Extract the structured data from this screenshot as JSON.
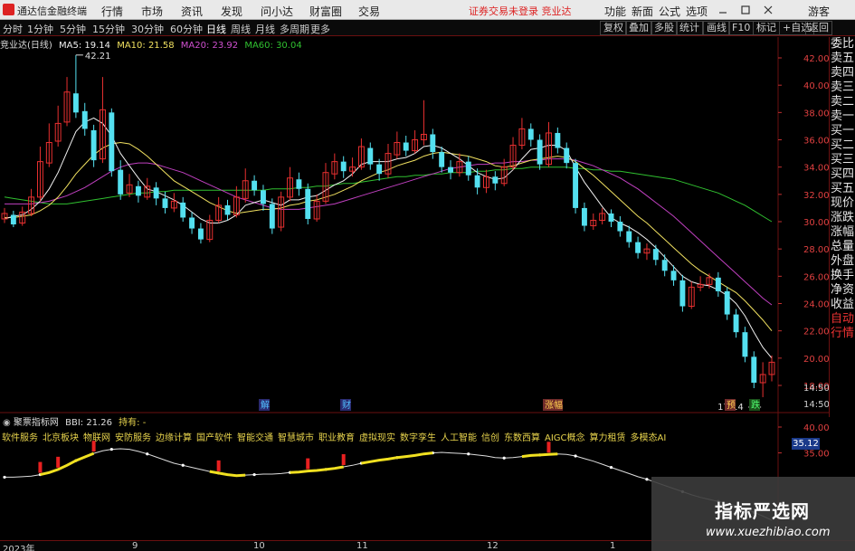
{
  "menubar": {
    "app_name": "通达信金融终端",
    "items": [
      "行情",
      "市场",
      "资讯",
      "发现",
      "问小达",
      "财富圈",
      "交易"
    ],
    "warning": "证券交易未登录 竞业达",
    "right_items": [
      "功能",
      "新面",
      "公式",
      "选项"
    ],
    "guest": "游客"
  },
  "toolbar": {
    "periods": [
      "分时",
      "1分钟",
      "5分钟",
      "15分钟",
      "30分钟",
      "60分钟",
      "日线",
      "周线",
      "月线",
      "多周期",
      "更多"
    ],
    "active_period": "日线",
    "right_buttons": [
      "复权",
      "叠加",
      "多股",
      "统计",
      "画线",
      "F10",
      "标记",
      "+自选",
      "返回"
    ]
  },
  "chart_header": {
    "stock": "竞业达(日线)",
    "ma5": "MA5: 19.14",
    "ma10": "MA10: 21.58",
    "ma20": "MA20: 23.92",
    "ma60": "MA60: 30.04"
  },
  "price_axis": {
    "ticks": [
      "42.00",
      "40.00",
      "38.00",
      "36.00",
      "34.00",
      "32.00",
      "30.00",
      "28.00",
      "26.00",
      "24.00",
      "22.00",
      "20.00",
      "18.00"
    ],
    "time_labels": [
      "14:50",
      "14:50",
      "14:50",
      "14:50"
    ]
  },
  "side_panel": [
    "委比",
    "卖五",
    "卖四",
    "卖三",
    "卖二",
    "卖一",
    "买一",
    "买二",
    "买三",
    "买四",
    "买五",
    "现价",
    "涨跌",
    "涨幅",
    "总量",
    "外盘",
    "换手",
    "净资",
    "收益",
    "自动",
    "行情"
  ],
  "markers": {
    "high_label": "42.21",
    "low_label": "17.14",
    "events": [
      "解",
      "财",
      "涨幅",
      "预",
      "跌"
    ]
  },
  "indicator": {
    "title": "聚票指标网",
    "bbi": "BBI: 21.26",
    "hold": "持有: -",
    "concepts": [
      "软件服务",
      "北京板块",
      "物联网",
      "安防服务",
      "边缘计算",
      "国产软件",
      "智能交通",
      "智慧城市",
      "职业教育",
      "虚拟现实",
      "数字孪生",
      "人工智能",
      "信创",
      "东数西算",
      "AIGC概念",
      "算力租赁",
      "多模态AI"
    ],
    "axis_ticks": [
      "40.00",
      "35.00"
    ],
    "current_value": "35.12"
  },
  "bottom_axis": [
    "2023年",
    "9",
    "10",
    "11",
    "12",
    "1"
  ],
  "watermark": {
    "title": "指标严选网",
    "url": "www.xuezhibiao.com"
  },
  "colors": {
    "up": "#e83030",
    "down": "#54e0f0",
    "ma5": "#f0f0f0",
    "ma10": "#f0e060",
    "ma20": "#c040c0",
    "ma60": "#30c030",
    "bg": "#000000",
    "axis": "#6a1010"
  },
  "chart_data": {
    "type": "candlestick",
    "title": "竞业达(日线)",
    "ylim": [
      17,
      43
    ],
    "candles": [
      {
        "o": 30.2,
        "c": 30.6,
        "h": 31.0,
        "l": 29.9
      },
      {
        "o": 30.5,
        "c": 29.8,
        "h": 30.8,
        "l": 29.6
      },
      {
        "o": 29.9,
        "c": 30.7,
        "h": 31.1,
        "l": 29.7
      },
      {
        "o": 30.6,
        "c": 31.8,
        "h": 32.4,
        "l": 30.4
      },
      {
        "o": 31.8,
        "c": 34.4,
        "h": 35.5,
        "l": 31.5
      },
      {
        "o": 34.3,
        "c": 35.8,
        "h": 37.2,
        "l": 34.0
      },
      {
        "o": 35.9,
        "c": 37.2,
        "h": 38.5,
        "l": 35.5
      },
      {
        "o": 37.3,
        "c": 39.5,
        "h": 40.6,
        "l": 37.0
      },
      {
        "o": 39.4,
        "c": 38.0,
        "h": 42.21,
        "l": 37.6
      },
      {
        "o": 38.1,
        "c": 36.8,
        "h": 38.7,
        "l": 36.3
      },
      {
        "o": 36.7,
        "c": 34.5,
        "h": 37.1,
        "l": 34.0
      },
      {
        "o": 34.6,
        "c": 38.2,
        "h": 40.6,
        "l": 34.3
      },
      {
        "o": 38.0,
        "c": 33.7,
        "h": 38.3,
        "l": 33.3
      },
      {
        "o": 33.8,
        "c": 32.0,
        "h": 34.5,
        "l": 31.6
      },
      {
        "o": 32.1,
        "c": 32.7,
        "h": 33.5,
        "l": 31.8
      },
      {
        "o": 32.6,
        "c": 31.9,
        "h": 33.0,
        "l": 31.4
      },
      {
        "o": 31.8,
        "c": 32.6,
        "h": 33.2,
        "l": 31.6
      },
      {
        "o": 32.5,
        "c": 31.7,
        "h": 32.9,
        "l": 31.2
      },
      {
        "o": 31.7,
        "c": 31.0,
        "h": 32.2,
        "l": 30.6
      },
      {
        "o": 31.0,
        "c": 31.5,
        "h": 32.1,
        "l": 30.7
      },
      {
        "o": 31.4,
        "c": 30.3,
        "h": 31.8,
        "l": 30.0
      },
      {
        "o": 30.3,
        "c": 29.5,
        "h": 30.7,
        "l": 29.1
      },
      {
        "o": 29.5,
        "c": 28.7,
        "h": 29.9,
        "l": 28.4
      },
      {
        "o": 28.7,
        "c": 30.1,
        "h": 30.5,
        "l": 28.5
      },
      {
        "o": 30.1,
        "c": 31.2,
        "h": 31.8,
        "l": 29.9
      },
      {
        "o": 31.2,
        "c": 30.5,
        "h": 31.6,
        "l": 30.1
      },
      {
        "o": 30.5,
        "c": 31.8,
        "h": 32.6,
        "l": 30.3
      },
      {
        "o": 31.7,
        "c": 33.0,
        "h": 33.9,
        "l": 31.4
      },
      {
        "o": 33.0,
        "c": 32.3,
        "h": 33.4,
        "l": 31.9
      },
      {
        "o": 32.3,
        "c": 31.3,
        "h": 32.7,
        "l": 30.8
      },
      {
        "o": 31.3,
        "c": 29.5,
        "h": 31.7,
        "l": 29.1
      },
      {
        "o": 29.6,
        "c": 31.8,
        "h": 32.2,
        "l": 29.3
      },
      {
        "o": 31.8,
        "c": 33.2,
        "h": 34.0,
        "l": 31.5
      },
      {
        "o": 33.1,
        "c": 32.4,
        "h": 33.6,
        "l": 31.9
      },
      {
        "o": 32.4,
        "c": 30.2,
        "h": 32.8,
        "l": 29.8
      },
      {
        "o": 30.2,
        "c": 31.5,
        "h": 32.0,
        "l": 30.0
      },
      {
        "o": 31.5,
        "c": 33.6,
        "h": 34.3,
        "l": 31.3
      },
      {
        "o": 33.5,
        "c": 34.4,
        "h": 35.0,
        "l": 33.1
      },
      {
        "o": 34.4,
        "c": 33.7,
        "h": 34.8,
        "l": 33.2
      },
      {
        "o": 33.7,
        "c": 34.0,
        "h": 34.7,
        "l": 33.3
      },
      {
        "o": 34.0,
        "c": 35.5,
        "h": 36.1,
        "l": 33.8
      },
      {
        "o": 35.4,
        "c": 34.2,
        "h": 35.8,
        "l": 33.8
      },
      {
        "o": 34.2,
        "c": 33.5,
        "h": 34.6,
        "l": 33.0
      },
      {
        "o": 33.5,
        "c": 35.0,
        "h": 35.7,
        "l": 33.2
      },
      {
        "o": 34.9,
        "c": 35.8,
        "h": 36.6,
        "l": 34.6
      },
      {
        "o": 35.8,
        "c": 35.2,
        "h": 36.3,
        "l": 34.8
      },
      {
        "o": 35.2,
        "c": 36.0,
        "h": 36.7,
        "l": 35.0
      },
      {
        "o": 36.0,
        "c": 36.4,
        "h": 38.9,
        "l": 35.6
      },
      {
        "o": 36.4,
        "c": 35.1,
        "h": 36.8,
        "l": 34.6
      },
      {
        "o": 35.1,
        "c": 34.0,
        "h": 35.5,
        "l": 33.6
      },
      {
        "o": 34.0,
        "c": 33.6,
        "h": 34.5,
        "l": 33.1
      },
      {
        "o": 33.6,
        "c": 34.4,
        "h": 35.0,
        "l": 33.3
      },
      {
        "o": 34.4,
        "c": 33.4,
        "h": 34.8,
        "l": 33.0
      },
      {
        "o": 33.4,
        "c": 32.5,
        "h": 33.9,
        "l": 32.0
      },
      {
        "o": 32.5,
        "c": 33.3,
        "h": 33.8,
        "l": 32.1
      },
      {
        "o": 33.3,
        "c": 32.8,
        "h": 33.7,
        "l": 32.3
      },
      {
        "o": 32.8,
        "c": 34.0,
        "h": 34.6,
        "l": 32.6
      },
      {
        "o": 34.0,
        "c": 35.6,
        "h": 36.2,
        "l": 33.8
      },
      {
        "o": 35.6,
        "c": 36.8,
        "h": 37.6,
        "l": 35.3
      },
      {
        "o": 36.8,
        "c": 36.0,
        "h": 37.2,
        "l": 35.5
      },
      {
        "o": 36.0,
        "c": 34.2,
        "h": 36.4,
        "l": 33.8
      },
      {
        "o": 34.2,
        "c": 36.5,
        "h": 37.3,
        "l": 34.0
      },
      {
        "o": 36.5,
        "c": 35.4,
        "h": 36.9,
        "l": 35.0
      },
      {
        "o": 35.4,
        "c": 34.3,
        "h": 35.8,
        "l": 33.9
      },
      {
        "o": 34.3,
        "c": 31.0,
        "h": 34.6,
        "l": 30.6
      },
      {
        "o": 31.0,
        "c": 29.7,
        "h": 31.4,
        "l": 29.3
      },
      {
        "o": 29.7,
        "c": 30.1,
        "h": 30.6,
        "l": 29.4
      },
      {
        "o": 30.1,
        "c": 30.6,
        "h": 31.0,
        "l": 29.8
      },
      {
        "o": 30.6,
        "c": 30.0,
        "h": 30.9,
        "l": 29.6
      },
      {
        "o": 30.0,
        "c": 29.3,
        "h": 30.4,
        "l": 28.9
      },
      {
        "o": 29.3,
        "c": 28.5,
        "h": 29.7,
        "l": 28.1
      },
      {
        "o": 28.5,
        "c": 27.7,
        "h": 28.9,
        "l": 27.3
      },
      {
        "o": 27.7,
        "c": 28.0,
        "h": 28.4,
        "l": 27.2
      },
      {
        "o": 28.0,
        "c": 27.2,
        "h": 28.3,
        "l": 26.8
      },
      {
        "o": 27.2,
        "c": 26.4,
        "h": 27.6,
        "l": 26.0
      },
      {
        "o": 26.4,
        "c": 25.7,
        "h": 26.8,
        "l": 25.3
      },
      {
        "o": 25.7,
        "c": 23.8,
        "h": 26.1,
        "l": 23.4
      },
      {
        "o": 23.8,
        "c": 25.2,
        "h": 25.6,
        "l": 23.6
      },
      {
        "o": 25.2,
        "c": 25.4,
        "h": 26.0,
        "l": 24.9
      },
      {
        "o": 25.4,
        "c": 25.9,
        "h": 26.2,
        "l": 25.1
      },
      {
        "o": 25.9,
        "c": 24.9,
        "h": 26.3,
        "l": 24.5
      },
      {
        "o": 24.9,
        "c": 23.2,
        "h": 25.2,
        "l": 22.8
      },
      {
        "o": 23.2,
        "c": 21.9,
        "h": 23.6,
        "l": 21.5
      },
      {
        "o": 21.9,
        "c": 20.1,
        "h": 22.3,
        "l": 19.7
      },
      {
        "o": 20.1,
        "c": 18.2,
        "h": 20.5,
        "l": 17.8
      },
      {
        "o": 18.2,
        "c": 18.8,
        "h": 19.7,
        "l": 17.14
      },
      {
        "o": 18.8,
        "c": 19.7,
        "h": 20.2,
        "l": 18.3
      }
    ],
    "ma5": [
      30.2,
      30.4,
      30.5,
      30.9,
      31.5,
      32.4,
      33.6,
      35.1,
      36.6,
      37.3,
      37.6,
      37.2,
      36.3,
      35.0,
      34.1,
      33.2,
      32.4,
      32.2,
      31.9,
      31.6,
      31.2,
      30.7,
      30.2,
      29.9,
      29.9,
      30.1,
      30.5,
      31.2,
      31.4,
      31.6,
      31.4,
      31.2,
      31.6,
      31.6,
      31.8,
      31.9,
      32.3,
      32.7,
      33.0,
      33.5,
      34.2,
      34.4,
      34.4,
      34.4,
      34.6,
      34.7,
      35.0,
      35.5,
      35.6,
      35.4,
      35.0,
      34.6,
      34.1,
      33.6,
      33.3,
      33.1,
      33.2,
      33.8,
      34.6,
      35.3,
      35.4,
      35.6,
      35.6,
      35.2,
      34.0,
      32.9,
      32.0,
      31.1,
      30.3,
      29.9,
      29.6,
      29.2,
      28.7,
      28.1,
      27.4,
      26.7,
      26.0,
      25.6,
      25.4,
      25.3,
      25.0,
      24.6,
      24.0,
      23.1,
      21.9,
      20.8,
      20.0
    ],
    "ma10": [
      30.3,
      30.3,
      30.4,
      30.5,
      30.8,
      31.2,
      31.8,
      32.6,
      33.5,
      34.2,
      34.9,
      35.4,
      35.7,
      35.8,
      35.7,
      35.3,
      34.8,
      34.2,
      33.6,
      33.0,
      32.6,
      32.2,
      31.8,
      31.4,
      31.1,
      30.8,
      30.6,
      30.7,
      30.8,
      30.9,
      30.9,
      31.0,
      31.2,
      31.3,
      31.5,
      31.6,
      31.8,
      32.0,
      32.3,
      32.6,
      33.0,
      33.3,
      33.6,
      33.8,
      34.1,
      34.3,
      34.5,
      34.8,
      35.0,
      35.1,
      35.0,
      34.9,
      34.8,
      34.6,
      34.4,
      34.1,
      34.0,
      34.1,
      34.3,
      34.5,
      34.6,
      34.7,
      34.8,
      34.7,
      34.4,
      33.9,
      33.4,
      32.8,
      32.2,
      31.6,
      31.0,
      30.4,
      29.9,
      29.3,
      28.7,
      28.1,
      27.5,
      26.9,
      26.4,
      26.0,
      25.6,
      25.2,
      24.8,
      24.2,
      23.5,
      22.8,
      22.0
    ],
    "ma20": [
      31.3,
      31.3,
      31.3,
      31.3,
      31.4,
      31.5,
      31.7,
      31.9,
      32.2,
      32.5,
      32.9,
      33.3,
      33.7,
      34.0,
      34.2,
      34.3,
      34.3,
      34.2,
      34.0,
      33.8,
      33.6,
      33.3,
      33.0,
      32.7,
      32.4,
      32.1,
      31.8,
      31.6,
      31.4,
      31.2,
      31.0,
      30.9,
      30.9,
      30.9,
      31.0,
      31.1,
      31.2,
      31.3,
      31.5,
      31.7,
      31.9,
      32.1,
      32.3,
      32.5,
      32.7,
      32.9,
      33.1,
      33.3,
      33.5,
      33.7,
      33.9,
      34.0,
      34.1,
      34.2,
      34.2,
      34.3,
      34.3,
      34.4,
      34.4,
      34.5,
      34.5,
      34.6,
      34.6,
      34.6,
      34.5,
      34.3,
      34.1,
      33.8,
      33.5,
      33.2,
      32.8,
      32.4,
      31.9,
      31.4,
      30.9,
      30.4,
      29.8,
      29.2,
      28.6,
      28.0,
      27.4,
      26.8,
      26.2,
      25.6,
      25.0,
      24.4,
      23.9
    ],
    "ma60": [
      31.8,
      31.7,
      31.6,
      31.5,
      31.4,
      31.3,
      31.3,
      31.3,
      31.4,
      31.5,
      31.6,
      31.7,
      31.8,
      31.9,
      32.0,
      32.1,
      32.1,
      32.2,
      32.2,
      32.3,
      32.3,
      32.3,
      32.3,
      32.3,
      32.3,
      32.3,
      32.3,
      32.3,
      32.3,
      32.3,
      32.4,
      32.4,
      32.4,
      32.5,
      32.5,
      32.6,
      32.6,
      32.7,
      32.8,
      32.8,
      32.9,
      33.0,
      33.1,
      33.2,
      33.3,
      33.3,
      33.4,
      33.4,
      33.5,
      33.5,
      33.6,
      33.6,
      33.6,
      33.7,
      33.7,
      33.8,
      33.8,
      33.9,
      33.9,
      34.0,
      34.0,
      34.0,
      34.0,
      34.0,
      33.9,
      33.9,
      33.8,
      33.8,
      33.7,
      33.7,
      33.6,
      33.5,
      33.4,
      33.3,
      33.2,
      33.1,
      32.9,
      32.7,
      32.5,
      32.3,
      32.1,
      31.8,
      31.5,
      31.2,
      30.8,
      30.4,
      30.0
    ]
  }
}
